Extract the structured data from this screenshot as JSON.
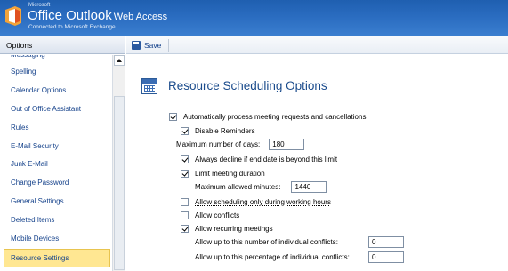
{
  "header": {
    "brand_small": "Microsoft",
    "product_main": "Office Outlook",
    "product_sub": "Web Access",
    "connection": "Connected to Microsoft Exchange"
  },
  "nav": {
    "title": "Options",
    "items": [
      "Messaging",
      "Spelling",
      "Calendar Options",
      "Out of Office Assistant",
      "Rules",
      "E-Mail Security",
      "Junk E-Mail",
      "Change Password",
      "General Settings",
      "Deleted Items",
      "Mobile Devices",
      "Resource Settings"
    ],
    "selected": "Resource Settings"
  },
  "toolbar": {
    "save_label": "Save"
  },
  "main": {
    "title": "Resource Scheduling Options",
    "auto_process": {
      "label": "Automatically process meeting requests and cancellations",
      "checked": true
    },
    "disable_reminders": {
      "label": "Disable Reminders",
      "checked": true
    },
    "max_days": {
      "label": "Maximum number of days:",
      "value": "180"
    },
    "decline_beyond": {
      "label": "Always decline if end date is beyond this limit",
      "checked": true
    },
    "limit_duration": {
      "label": "Limit meeting duration",
      "checked": true
    },
    "max_minutes": {
      "label": "Maximum allowed minutes:",
      "value": "1440"
    },
    "working_hours": {
      "label": "Allow scheduling only during working hours",
      "checked": false
    },
    "allow_conflicts": {
      "label": "Allow conflicts",
      "checked": false
    },
    "allow_recurring": {
      "label": "Allow recurring meetings",
      "checked": true
    },
    "conflict_count": {
      "label": "Allow up to this number of individual conflicts:",
      "value": "0"
    },
    "conflict_pct": {
      "label": "Allow up to this percentage of individual conflicts:",
      "value": "0"
    }
  }
}
